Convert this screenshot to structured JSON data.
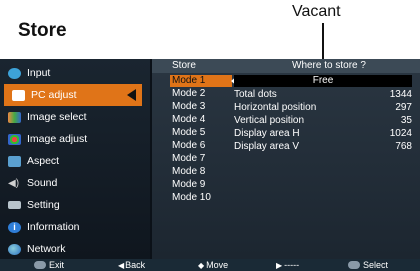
{
  "title": "Store",
  "callout": "Vacant",
  "sidebar": {
    "items": [
      {
        "label": "Input",
        "icon": "input-icon",
        "color": "#3da2d8",
        "active": false
      },
      {
        "label": "PC adjust",
        "icon": "pc-adjust-icon",
        "color": "#ffffff",
        "active": true
      },
      {
        "label": "Image select",
        "icon": "image-select-icon",
        "color": "#3aa3d0",
        "active": false
      },
      {
        "label": "Image adjust",
        "icon": "image-adjust-icon",
        "color": "#d94848",
        "active": false
      },
      {
        "label": "Aspect",
        "icon": "aspect-icon",
        "color": "#5aa0d0",
        "active": false
      },
      {
        "label": "Sound",
        "icon": "sound-icon",
        "color": "#d0d0d0",
        "active": false
      },
      {
        "label": "Setting",
        "icon": "setting-icon",
        "color": "#b8c4cc",
        "active": false
      },
      {
        "label": "Information",
        "icon": "information-icon",
        "color": "#2f7ed8",
        "active": false
      },
      {
        "label": "Network",
        "icon": "network-icon",
        "color": "#3a8fd8",
        "active": false
      }
    ]
  },
  "submenu": {
    "store_label": "Store",
    "where_label": "Where to store ?",
    "modes": [
      "Mode 1",
      "Mode 2",
      "Mode 3",
      "Mode 4",
      "Mode 5",
      "Mode 6",
      "Mode 7",
      "Mode 8",
      "Mode 9",
      "Mode 10"
    ],
    "active_mode": "Mode 1",
    "free_label": "Free",
    "info": [
      {
        "label": "Total dots",
        "value": "1344"
      },
      {
        "label": "Horizontal position",
        "value": "297"
      },
      {
        "label": "Vertical position",
        "value": "35"
      },
      {
        "label": "Display area H",
        "value": "1024"
      },
      {
        "label": "Display area V",
        "value": "768"
      }
    ]
  },
  "footer": {
    "exit": "Exit",
    "back": "Back",
    "move": "Move",
    "next": "-----",
    "select": "Select"
  },
  "colors": {
    "accent": "#e07418",
    "background": "#0b1118"
  }
}
